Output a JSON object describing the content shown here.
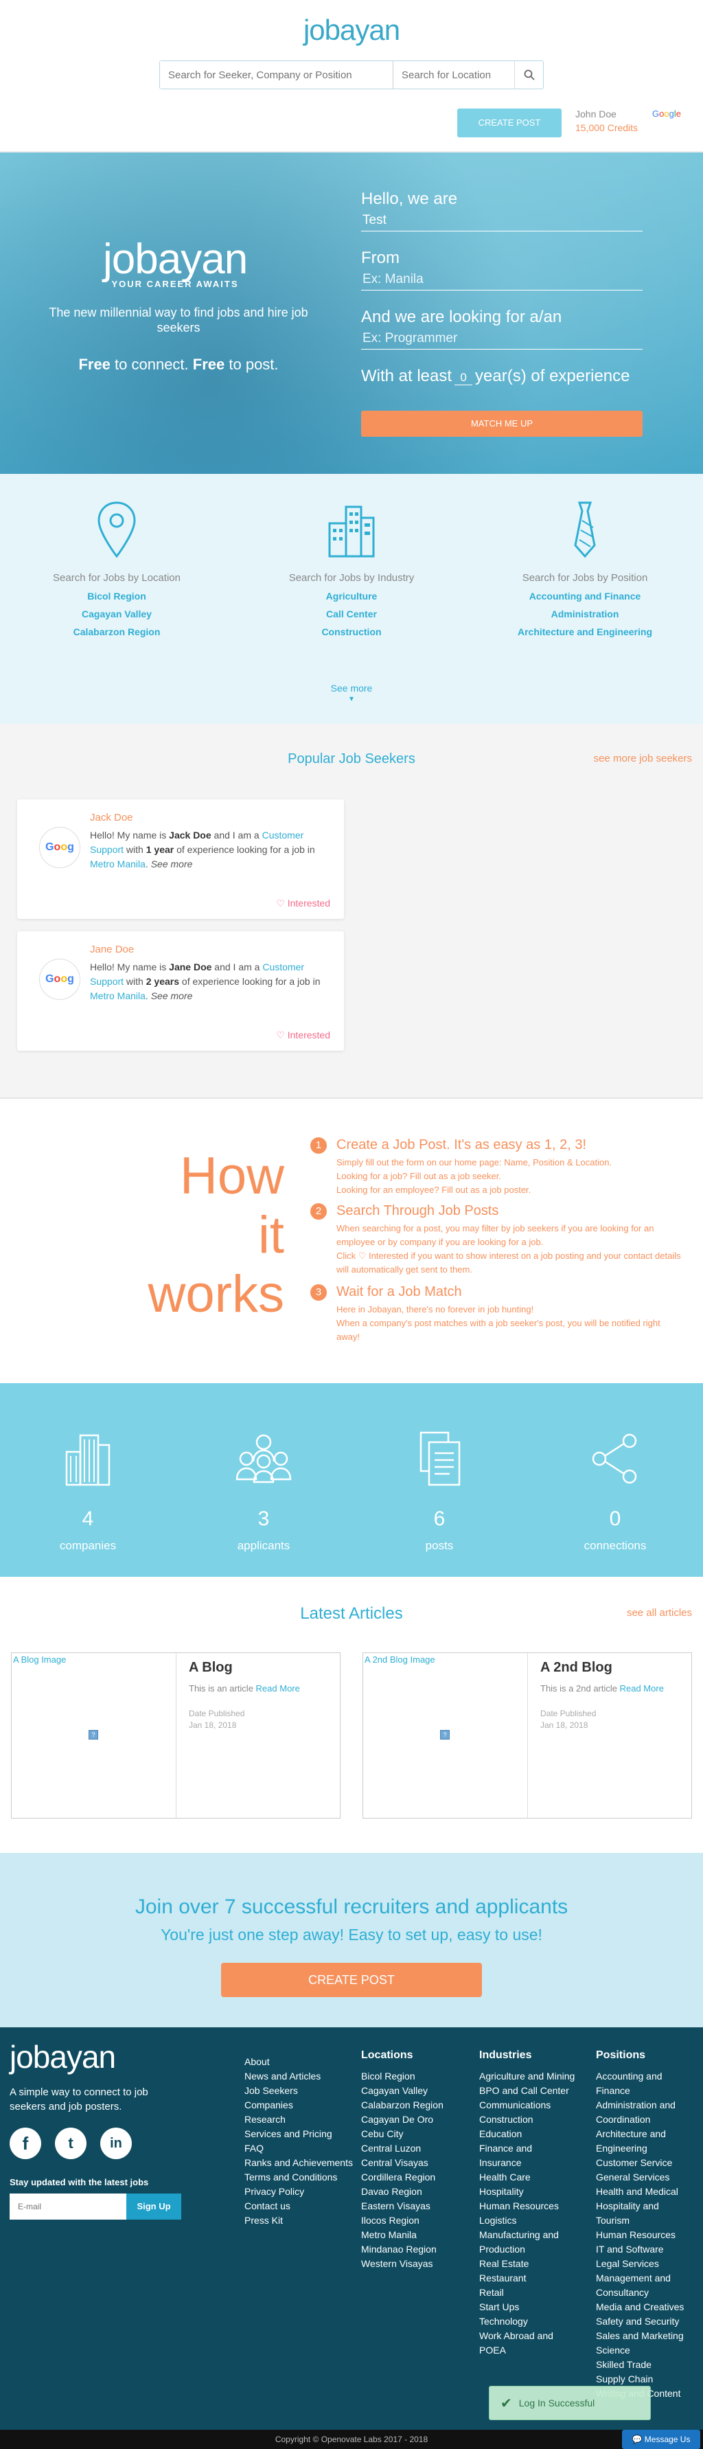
{
  "header": {
    "logo": "jobayan",
    "search_placeholder": "Search for Seeker, Company or Position",
    "location_placeholder": "Search for Location",
    "create_post": "CREATE POST",
    "user_name": "John Doe",
    "credits": "15,000 Credits",
    "avatar_label": "Google"
  },
  "hero": {
    "logo": "jobayan",
    "tagline": "YOUR CAREER AWAITS",
    "desc": "The new millennial way to find jobs and hire job seekers",
    "free1": "Free",
    "free_mid": " to connect. ",
    "free2": "Free",
    "free_end": " to post.",
    "hello_label": "Hello, we are",
    "hello_value": "Test",
    "from_label": "From",
    "from_placeholder": "Ex: Manila",
    "looking_label": "And we are looking for a/an",
    "looking_placeholder": "Ex: Programmer",
    "exp_pre": "With at least",
    "exp_value": "0",
    "exp_post": "year(s) of experience",
    "match_button": "MATCH ME UP"
  },
  "categories": [
    {
      "title": "Search for Jobs by Location",
      "items": [
        "Bicol Region",
        "Cagayan Valley",
        "Calabarzon Region"
      ]
    },
    {
      "title": "Search for Jobs by Industry",
      "items": [
        "Agriculture",
        "Call Center",
        "Construction"
      ]
    },
    {
      "title": "Search for Jobs by Position",
      "items": [
        "Accounting and Finance",
        "Administration",
        "Architecture and Engineering"
      ]
    }
  ],
  "see_more": "See more",
  "popular": {
    "title": "Popular Job Seekers",
    "see_more": "see more job seekers",
    "avatar_label": "Google",
    "cards": [
      {
        "name": "Jack Doe",
        "t1": "Hello! My name is ",
        "bold_name": "Jack Doe",
        "t2": " and I am a ",
        "position": "Customer Support",
        "t3": " with ",
        "years": "1 year",
        "t4": " of experience looking for a job in ",
        "location": "Metro Manila",
        "t5": ". ",
        "see_more": "See more",
        "interested": "♡ Interested"
      },
      {
        "name": "Jane Doe",
        "t1": "Hello! My name is ",
        "bold_name": "Jane Doe",
        "t2": " and I am a ",
        "position": "Customer Support",
        "t3": " with ",
        "years": "2 years",
        "t4": " of experience looking for a job in ",
        "location": "Metro Manila",
        "t5": ". ",
        "see_more": "See more",
        "interested": "♡ Interested"
      }
    ]
  },
  "how": {
    "big1": "How",
    "big2": "it",
    "big3": "works",
    "steps": [
      {
        "num": "1",
        "title": "Create a Job Post. It's as easy as 1, 2, 3!",
        "lines": [
          "Simply fill out the form on our home page: Name, Position & Location.",
          "Looking for a job? Fill out as a job seeker.",
          "Looking for an employee? Fill out as a job poster."
        ]
      },
      {
        "num": "2",
        "title": "Search Through Job Posts",
        "lines": [
          "When searching for a post, you may filter by job seekers if you are looking for an employee or by company if you are looking for a job.",
          "Click ♡ Interested if you want to show interest on a job posting and your contact details will automatically get sent to them."
        ]
      },
      {
        "num": "3",
        "title": "Wait for a Job Match",
        "lines": [
          "Here in Jobayan, there's no forever in job hunting!",
          "When a company's post matches with a job seeker's post, you will be notified right away!"
        ]
      }
    ]
  },
  "stats": [
    {
      "value": "4",
      "label": "companies",
      "icon": "building-icon"
    },
    {
      "value": "3",
      "label": "applicants",
      "icon": "people-icon"
    },
    {
      "value": "6",
      "label": "posts",
      "icon": "documents-icon"
    },
    {
      "value": "0",
      "label": "connections",
      "icon": "share-icon"
    }
  ],
  "blog": {
    "title": "Latest Articles",
    "see_all": "see all articles",
    "posts": [
      {
        "img_alt": "A Blog Image",
        "title": "A Blog",
        "desc": "This is an article ",
        "read_more": "Read More",
        "date_label": "Date Published",
        "date": "Jan 18, 2018"
      },
      {
        "img_alt": "A 2nd Blog Image",
        "title": "A 2nd Blog",
        "desc": "This is a 2nd article ",
        "read_more": "Read More",
        "date_label": "Date Published",
        "date": "Jan 18, 2018"
      }
    ]
  },
  "join": {
    "title": "Join over 7 successful recruiters and applicants",
    "subtitle": "You're just one step away! Easy to set up, easy to use!",
    "button": "CREATE POST"
  },
  "footer": {
    "logo": "jobayan",
    "desc": "A simple way to connect to job seekers and job posters.",
    "updated": "Stay updated with the latest jobs",
    "email_placeholder": "E-mail",
    "signup": "Sign Up",
    "links": [
      "About",
      "News and Articles",
      "Job Seekers",
      "Companies",
      "Research",
      "Services and Pricing",
      "FAQ",
      "Ranks and Achievements",
      "Terms and Conditions",
      "Privacy Policy",
      "Contact us",
      "Press Kit"
    ],
    "locations_title": "Locations",
    "locations": [
      "Bicol Region",
      "Cagayan Valley",
      "Calabarzon Region",
      "Cagayan De Oro",
      "Cebu City",
      "Central Luzon",
      "Central Visayas",
      "Cordillera Region",
      "Davao Region",
      "Eastern Visayas",
      "Ilocos Region",
      "Metro Manila",
      "Mindanao Region",
      "Western Visayas"
    ],
    "industries_title": "Industries",
    "industries": [
      "Agriculture and Mining",
      "BPO and Call Center",
      "Communications",
      "Construction",
      "Education",
      "Finance and Insurance",
      "Health Care",
      "Hospitality",
      "Human Resources",
      "Logistics",
      "Manufacturing and Production",
      "Real Estate",
      "Restaurant",
      "Retail",
      "Start Ups",
      "Technology",
      "Work Abroad and POEA"
    ],
    "positions_title": "Positions",
    "positions": [
      "Accounting and Finance",
      "Administration and Coordination",
      "Architecture and Engineering",
      "Customer Service",
      "General Services",
      "Health and Medical",
      "Hospitality and Tourism",
      "Human Resources",
      "IT and Software",
      "Legal Services",
      "Management and Consultancy",
      "Media and Creatives",
      "Safety and Security",
      "Sales and Marketing",
      "Science",
      "Skilled Trade",
      "Supply Chain",
      "Writing and Content"
    ],
    "copyright": "Copyright © Openovate Labs 2017 - 2018"
  },
  "toast": "Log In Successful",
  "message_us": "Message Us"
}
